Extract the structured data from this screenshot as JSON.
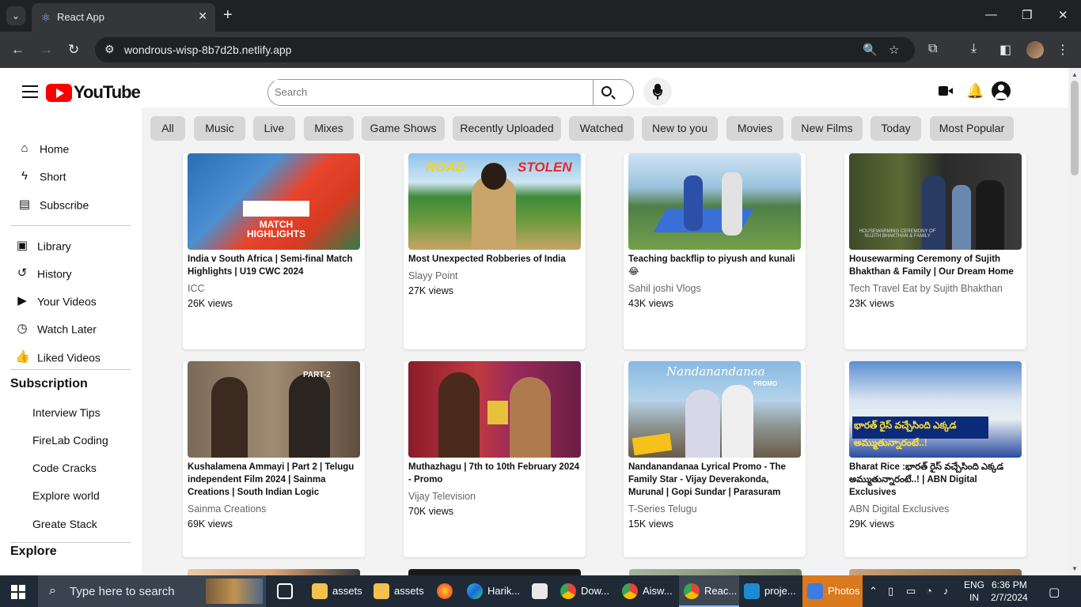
{
  "browser": {
    "tab_title": "React App",
    "url": "wondrous-wisp-8b7d2b.netlify.app"
  },
  "header": {
    "logo_text": "YouTube",
    "search_placeholder": "Search"
  },
  "sidebar": {
    "main": [
      "Home",
      "Short",
      "Subscribe"
    ],
    "library": [
      "Library",
      "History",
      "Your Videos",
      "Watch Later",
      "Liked Videos"
    ],
    "subscription_heading": "Subscription",
    "subscriptions": [
      "Interview Tips",
      "FireLab Coding",
      "Code Cracks",
      "Explore world",
      "Greate Stack"
    ],
    "explore_heading": "Explore"
  },
  "chips": [
    "All",
    "Music",
    "Live",
    "Mixes",
    "Game Shows",
    "Recently Uploaded",
    "Watched",
    "New to you",
    "Movies",
    "New Films",
    "Today",
    "Most Popular"
  ],
  "videos": [
    {
      "title": "India v South Africa | Semi-final Match Highlights | U19 CWC 2024",
      "channel": "ICC",
      "views": "26K views"
    },
    {
      "title": "Most Unexpected Robberies of India",
      "channel": "Slayy Point",
      "views": "27K views"
    },
    {
      "title": "Teaching backflip to piyush and kunali 😂",
      "channel": "Sahil joshi Vlogs",
      "views": "43K views"
    },
    {
      "title": "Housewarming Ceremony of Sujith Bhakthan & Family | Our Dream Home",
      "channel": "Tech Travel Eat by Sujith Bhakthan",
      "views": "23K views"
    },
    {
      "title": "Kushalamena Ammayi | Part 2 | Telugu independent Film 2024 | Sainma Creations | South Indian Logic",
      "channel": "Sainma Creations",
      "views": "69K views"
    },
    {
      "title": "Muthazhagu | 7th to 10th February 2024 - Promo",
      "channel": "Vijay Television",
      "views": "70K views"
    },
    {
      "title": "Nandanandanaa Lyrical Promo - The Family Star - Vijay Deverakonda, Murunal | Gopi Sundar | Parasuram",
      "channel": "T-Series Telugu",
      "views": "15K views"
    },
    {
      "title": "Bharat Rice :భారత్ రైస్ వచ్చేసింది ఎక్కడ అమ్ముతున్నారంటే..! | ABN Digital Exclusives",
      "channel": "ABN Digital Exclusives",
      "views": "29K views"
    }
  ],
  "thumb_text": {
    "t1": "MATCH HIGHLIGHTS",
    "t2a": "ROAD",
    "t2b": "STOLEN",
    "t4": "HOUSEWARMING CEREMONY OF SUJITH BHAKTHAN & FAMILY",
    "t5": "PART-2",
    "t7a": "Nandanandanaa",
    "t7b": "PROMO",
    "t8": "భారత్ రైస్ వచ్చేసింది ఎక్కడ అమ్ముతున్నారంటే..!"
  },
  "taskbar": {
    "search_text": "Type here to search",
    "apps": [
      "assets",
      "assets",
      "Harik...",
      "Dow...",
      "Aisw...",
      "Reac...",
      "proje...",
      "Photos"
    ],
    "lang1": "ENG",
    "lang2": "IN",
    "time": "6:36 PM",
    "date": "2/7/2024"
  },
  "colors": {
    "brand": "#ff0000",
    "chrome_dark": "#202124",
    "chip_bg": "#d6d6d6"
  }
}
